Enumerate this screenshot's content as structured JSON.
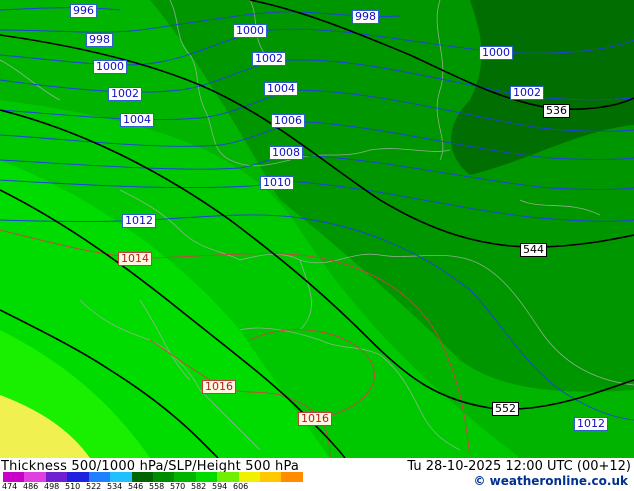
{
  "title": "Thickness 500/1000 hPa/SLP/Height 500 hPa",
  "valid_time": "Tu 28-10-2025 12:00 UTC (00+12)",
  "credit": "© weatheronline.co.uk",
  "legend": {
    "ticks": [
      "474",
      "486",
      "498",
      "510",
      "522",
      "534",
      "546",
      "558",
      "570",
      "582",
      "594",
      "606"
    ],
    "colors": [
      "#c800c8",
      "#e040e0",
      "#7020d0",
      "#2020e0",
      "#2080ff",
      "#20c0ff",
      "#006400",
      "#008c00",
      "#00b400",
      "#00dc00",
      "#70f000",
      "#f0f000",
      "#ffc800",
      "#ff8c00"
    ]
  },
  "isobars": [
    {
      "label": "996",
      "value": 996
    },
    {
      "label": "998",
      "value": 998
    },
    {
      "label": "1000",
      "value": 1000
    },
    {
      "label": "1002",
      "value": 1002
    },
    {
      "label": "1004",
      "value": 1004
    },
    {
      "label": "1006",
      "value": 1006
    },
    {
      "label": "1008",
      "value": 1008
    },
    {
      "label": "1010",
      "value": 1010
    },
    {
      "label": "1012",
      "value": 1012
    },
    {
      "label": "1014",
      "value": 1014
    },
    {
      "label": "1016",
      "value": 1016
    }
  ],
  "map_labels": {
    "l996": "996",
    "l998a": "998",
    "l998b": "998",
    "l1000a": "1000",
    "l1000b": "1000",
    "l1000c": "1000",
    "l1002a": "1002",
    "l1002b": "1002",
    "l1002c": "1002",
    "l1004a": "1004",
    "l1004b": "1004",
    "l1006": "1006",
    "l1008": "1008",
    "l1010": "1010",
    "l1012a": "1012",
    "l1012b": "1012",
    "l1014": "1014",
    "l1016a": "1016",
    "l1016b": "1016",
    "g536": "536",
    "g544": "544",
    "g552": "552"
  },
  "geopotential": [
    {
      "label": "536",
      "value": 536
    },
    {
      "label": "544",
      "value": 544
    },
    {
      "label": "552",
      "value": 552
    }
  ]
}
